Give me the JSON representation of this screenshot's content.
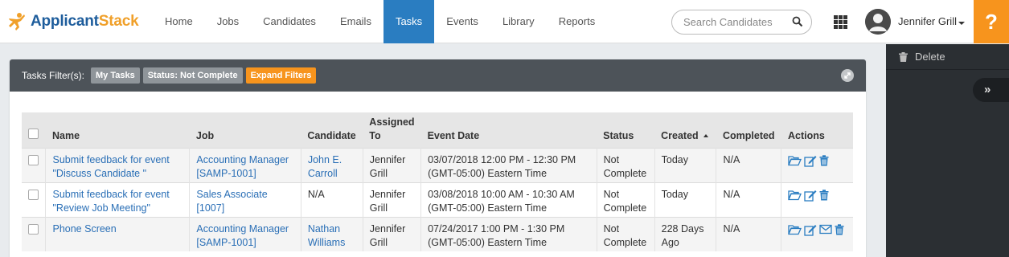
{
  "brand": {
    "part1": "Applicant",
    "part2": "Stack"
  },
  "nav": {
    "items": [
      "Home",
      "Jobs",
      "Candidates",
      "Emails",
      "Tasks",
      "Events",
      "Library",
      "Reports"
    ],
    "active": "Tasks"
  },
  "search": {
    "placeholder": "Search Candidates"
  },
  "user": {
    "name": "Jennifer Grill"
  },
  "help": {
    "label": "?"
  },
  "right_panel": {
    "delete_label": "Delete",
    "toggle_label": "»"
  },
  "filters": {
    "title": "Tasks Filter(s):",
    "tags": [
      "My Tasks",
      "Status: Not Complete"
    ],
    "expand_label": "Expand Filters"
  },
  "table": {
    "headers": {
      "name": "Name",
      "job": "Job",
      "candidate": "Candidate",
      "assigned_line1": "Assigned",
      "assigned_line2": "To",
      "event_date": "Event Date",
      "status": "Status",
      "created": "Created",
      "completed": "Completed",
      "actions": "Actions"
    },
    "rows": [
      {
        "name_l1": "Submit feedback for event",
        "name_l2": "\"Discuss Candidate \"",
        "job_l1": "Accounting Manager",
        "job_l2": "[SAMP-1001]",
        "cand_l1": "John E.",
        "cand_l2": "Carroll",
        "assign_l1": "Jennifer",
        "assign_l2": "Grill",
        "date_l1": "03/07/2018 12:00 PM - 12:30 PM",
        "date_l2": "(GMT-05:00) Eastern Time",
        "status_l1": "Not",
        "status_l2": "Complete",
        "created_l1": "Today",
        "created_l2": "",
        "completed": "N/A"
      },
      {
        "name_l1": "Submit feedback for event",
        "name_l2": "\"Review Job Meeting\"",
        "job_l1": "Sales Associate",
        "job_l2": "[1007]",
        "cand_l1": "N/A",
        "cand_l2": "",
        "assign_l1": "Jennifer",
        "assign_l2": "Grill",
        "date_l1": "03/08/2018 10:00 AM - 10:30 AM",
        "date_l2": "(GMT-05:00) Eastern Time",
        "status_l1": "Not",
        "status_l2": "Complete",
        "created_l1": "Today",
        "created_l2": "",
        "completed": "N/A"
      },
      {
        "name_l1": "Phone Screen",
        "name_l2": "",
        "job_l1": "Accounting Manager",
        "job_l2": "[SAMP-1001]",
        "cand_l1": "Nathan",
        "cand_l2": "Williams",
        "assign_l1": "Jennifer",
        "assign_l2": "Grill",
        "date_l1": "07/24/2017 1:00 PM - 1:30 PM",
        "date_l2": "(GMT-05:00) Eastern Time",
        "status_l1": "Not",
        "status_l2": "Complete",
        "created_l1": "228 Days",
        "created_l2": "Ago",
        "completed": "N/A"
      }
    ]
  },
  "colors": {
    "nav_active": "#2a7dc1",
    "brand_blue": "#1e5d9c",
    "brand_orange": "#f0a02a",
    "help_bg": "#f7941d",
    "link": "#2a6fb6",
    "filter_bar": "#4d5359"
  },
  "icons": [
    "search-icon",
    "apps-grid-icon",
    "user-avatar-icon",
    "caret-down-icon",
    "trash-icon",
    "double-chevron-right-icon",
    "expand-arrows-icon",
    "folder-open-icon",
    "edit-icon",
    "envelope-icon"
  ]
}
